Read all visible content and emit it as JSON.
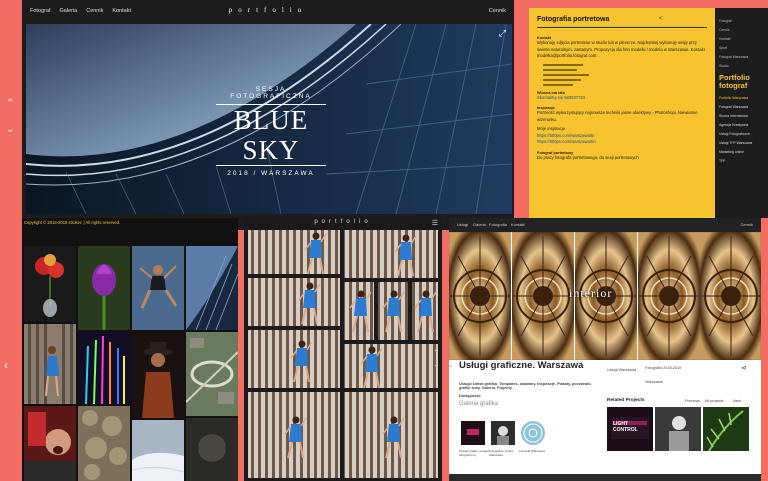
{
  "panel1": {
    "nav": [
      "Fotograf",
      "Galeria",
      "Cennik",
      "Kontakt"
    ],
    "logo": "portfolio",
    "lang": "Cennik",
    "hero_subtitle": "SESJA FOTOGRAFICZNA",
    "hero_title": "BLUE SKY",
    "hero_date": "2018 / WARSZAWA",
    "footer_prefix": "Copyright © 2016-2019",
    "footer_author": "stroker",
    "footer_suffix": ". | All rights reserved."
  },
  "panel2": {
    "title": "Fotografia portretowa",
    "label1": "Kontakt",
    "body1": "Wykonuję zdjęcia portretowe w studio lub w plenerze. Najchętniej wykonuję sesję przy świetle naturalnym, zastanym. Propozycja dla foto modelki / modela w Warszawie. Kontakt modelka@portfolio.fotograf.com",
    "label2": "Wiosna lub lato",
    "link1": "Skontaktuj się 583537723",
    "label3": "Inspiracje",
    "body2": "Portrecitć wykorzystujący najnowsze techniki jasne obiektywy - Photoshopi. Niewiarnie wizerunku.",
    "label4": "Moje inspiracje",
    "link2": "https://500px.com/warszawa/tn",
    "link3": "https://500px.com/warszawa/tm",
    "label5": "Fotograf portretowy",
    "body3": "Do pracy fotografa portretowego, do sesji portretowych",
    "side_menu": [
      "Fotograf",
      "Cennik",
      "Kontakt",
      "Sport",
      "Fotograf Warszawa",
      "Studio"
    ],
    "side_big": "Portfolio fotograf",
    "side_links": [
      "Portfolio Warszawa",
      "Fotograf Warszawa"
    ],
    "side_items": [
      "Strona Internetowa",
      "Agencja Kreatywna",
      "Usługi Fotograficzne",
      "Usługi TFP Warszawa",
      "Marketing online",
      "TFP"
    ]
  },
  "panel3": {
    "copyright_prefix": "Copyright © 2016-2019",
    "copyright_author": "stroker",
    "copyright_suffix": ". | All rights reserved."
  },
  "panel4": {
    "logo": "portfolio"
  },
  "panel5": {
    "nav": [
      "Usługi",
      "Galeria",
      "Fotografia",
      "Kontakt"
    ],
    "lang": "Cennik",
    "overlay_text": "interior",
    "title": "Usługi graficzne. Warszawa",
    "meta1": "Usługi Warszawa",
    "meta2": "Fotografia 2018-2019",
    "meta3": "Warszawa",
    "desc": "Usługi/ Łatwa grafika. Templates, zaawany, inspiracje. Plakaty, pocztówki, grafiki kimy. Galeria. Projekty.",
    "section1": "Dostępność",
    "gallery_title": "Galeria grafika",
    "thumb_labels": [
      "Projekt grafiki / projekt fotograficzny",
      "Fotografia / Studio Warszawa",
      "Fotograf Warszawa"
    ],
    "related": "Related Projects",
    "related_nav": [
      "Previous",
      "All projects",
      "Next"
    ],
    "related_overlay": "LIGHT CONTROL"
  },
  "colors": {
    "background": "#f46d63",
    "accent_yellow": "#f7c32e",
    "dark": "#1c1c1c"
  }
}
